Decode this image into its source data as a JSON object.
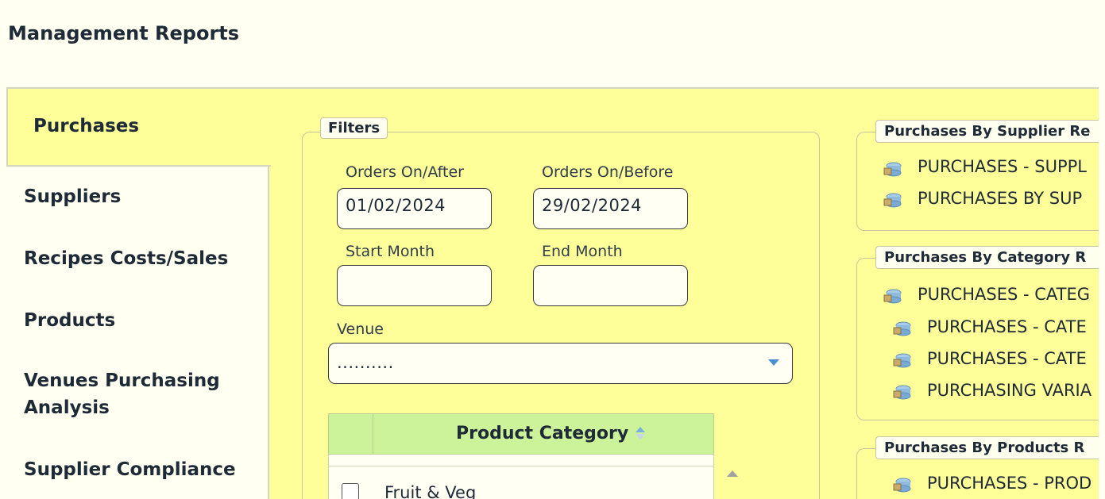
{
  "page": {
    "title": "Management Reports"
  },
  "nav": {
    "active": "Purchases",
    "items": [
      "Suppliers",
      "Recipes Costs/Sales",
      "Products",
      "Venues Purchasing",
      "Analysis",
      "Supplier Compliance"
    ]
  },
  "filters": {
    "legend": "Filters",
    "orders_after": {
      "label": "Orders On/After",
      "value": "01/02/2024"
    },
    "orders_before": {
      "label": "Orders On/Before",
      "value": "29/02/2024"
    },
    "start_month": {
      "label": "Start Month",
      "value": ""
    },
    "end_month": {
      "label": "End Month",
      "value": ""
    },
    "venue": {
      "label": "Venue",
      "value": ".........."
    }
  },
  "grid": {
    "header": "Product Category",
    "rows": [
      "Fruit & Veg"
    ]
  },
  "reports": {
    "supplier": {
      "legend": "Purchases By Supplier Re",
      "links": [
        "PURCHASES - SUPPL",
        "PURCHASES BY SUP"
      ]
    },
    "category": {
      "legend": "Purchases By Category R",
      "links": [
        "PURCHASES - CATEG",
        "PURCHASES - CATE",
        "PURCHASES - CATE",
        "PURCHASING VARIA"
      ]
    },
    "products": {
      "legend": "Purchases By Products R",
      "links": [
        "PURCHASES - PROD"
      ]
    }
  },
  "colors": {
    "panel": "#ffff99",
    "page_bg": "#fffff2",
    "grid_header": "#ccf39a",
    "accent_arrow": "#4a8fcf"
  },
  "icons": {
    "report": "report-db-icon",
    "dropdown": "chevron-down-icon",
    "sort": "sort-icon"
  }
}
